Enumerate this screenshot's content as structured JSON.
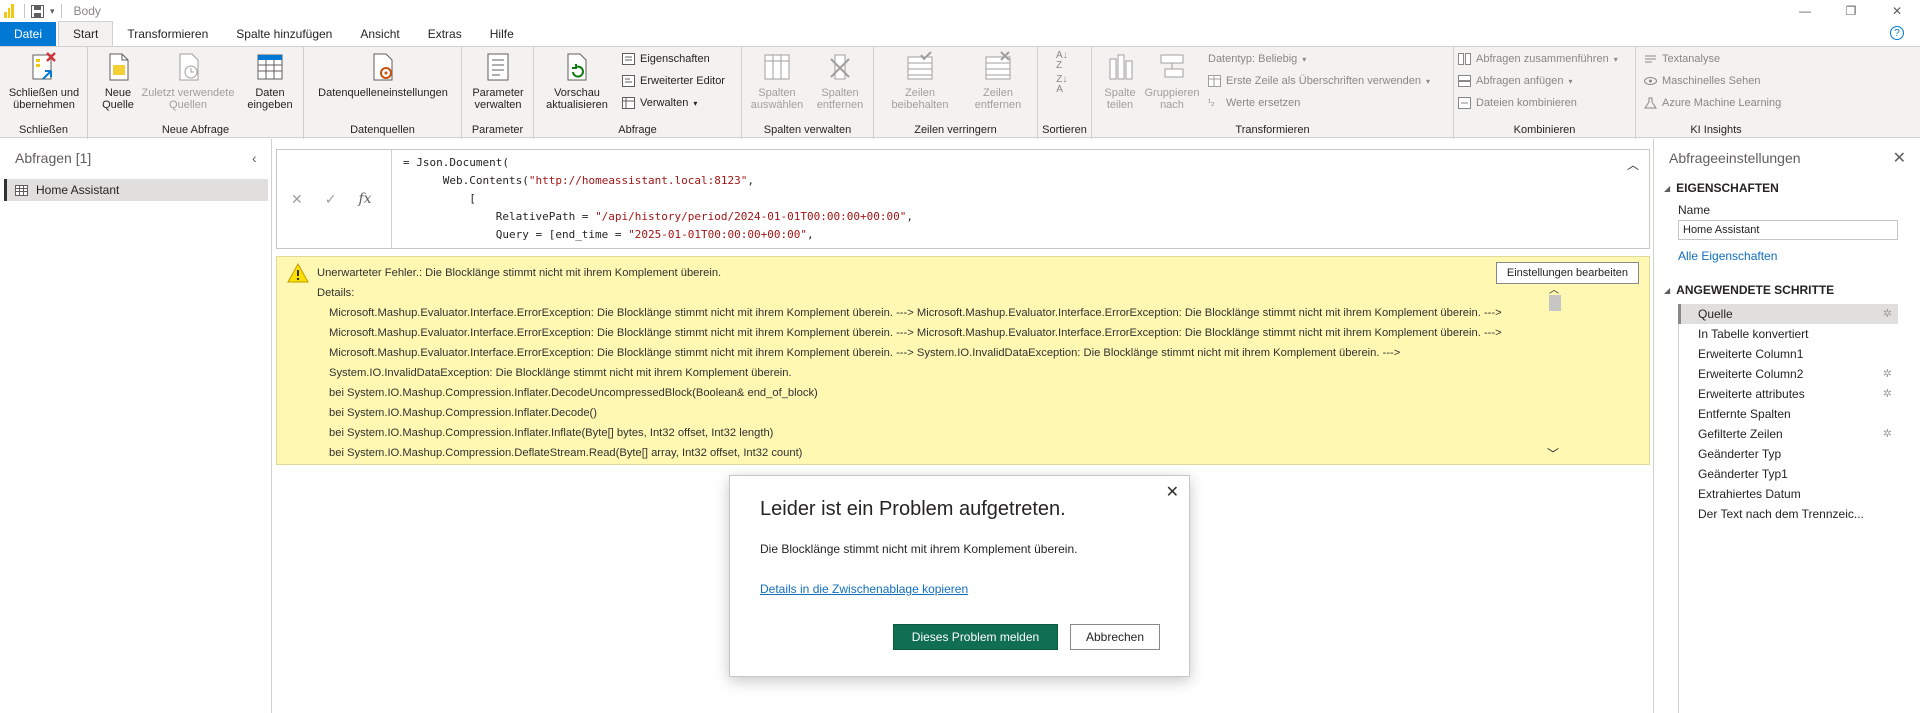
{
  "window": {
    "title": "Body",
    "controls": [
      "—",
      "❐",
      "✕"
    ]
  },
  "tabs": [
    "Datei",
    "Start",
    "Transformieren",
    "Spalte hinzufügen",
    "Ansicht",
    "Extras",
    "Hilfe"
  ],
  "ribbon": {
    "close_apply": "Schließen und übernehmen",
    "group_close": "Schließen",
    "new_source": "Neue Quelle",
    "recent_sources": "Zuletzt verwendete Quellen",
    "enter_data": "Daten eingeben",
    "group_new_query": "Neue Abfrage",
    "ds_settings": "Datenquelleneinstellungen",
    "group_datasources": "Datenquellen",
    "manage_params": "Parameter verwalten",
    "group_params": "Parameter",
    "refresh_preview": "Vorschau aktualisieren",
    "properties": "Eigenschaften",
    "advanced_editor": "Erweiterter Editor",
    "manage": "Verwalten",
    "group_query": "Abfrage",
    "choose_cols": "Spalten auswählen",
    "remove_cols": "Spalten entfernen",
    "group_manage_cols": "Spalten verwalten",
    "keep_rows": "Zeilen beibehalten",
    "remove_rows": "Zeilen entfernen",
    "group_reduce_rows": "Zeilen verringern",
    "group_sort": "Sortieren",
    "split_col": "Spalte teilen",
    "group_by": "Gruppieren nach",
    "datatype": "Datentyp: Beliebig",
    "first_row_headers": "Erste Zeile als Überschriften verwenden",
    "replace_values": "Werte ersetzen",
    "group_transform": "Transformieren",
    "merge_queries": "Abfragen zusammenführen",
    "append_queries": "Abfragen anfügen",
    "combine_files": "Dateien kombinieren",
    "group_combine": "Kombinieren",
    "text_analysis": "Textanalyse",
    "vision": "Maschinelles Sehen",
    "azure_ml": "Azure Machine Learning",
    "group_ai": "KI Insights"
  },
  "queries": {
    "header": "Abfragen [1]",
    "items": [
      "Home Assistant"
    ]
  },
  "formula": {
    "fx": "fx",
    "line1": "= Json.Document(",
    "line2a": "Web.Contents(",
    "line2b": "\"http://homeassistant.local:8123\"",
    "line2c": ",",
    "line3": "[",
    "line4a": "RelativePath = ",
    "line4b": "\"/api/history/period/2024-01-01T00:00:00+00:00\"",
    "line4c": ",",
    "line5a": "Query = [end_time = ",
    "line5b": "\"2025-01-01T00:00:00+00:00\"",
    "line5c": ","
  },
  "error": {
    "headline": "Unerwarteter Fehler.: Die Blocklänge stimmt nicht mit ihrem Komplement überein.",
    "details_label": "Details:",
    "detail_text": "Microsoft.Mashup.Evaluator.Interface.ErrorException: Die Blocklänge stimmt nicht mit ihrem Komplement überein. ---> Microsoft.Mashup.Evaluator.Interface.ErrorException: Die Blocklänge stimmt nicht mit ihrem Komplement überein. ---> Microsoft.Mashup.Evaluator.Interface.ErrorException: Die Blocklänge stimmt nicht mit ihrem Komplement überein. ---> Microsoft.Mashup.Evaluator.Interface.ErrorException: Die Blocklänge stimmt nicht mit ihrem Komplement überein. ---> Microsoft.Mashup.Evaluator.Interface.ErrorException: Die Blocklänge stimmt nicht mit ihrem Komplement überein. ---> System.IO.InvalidDataException: Die Blocklänge stimmt nicht mit ihrem Komplement überein. ---> System.IO.InvalidDataException: Die Blocklänge stimmt nicht mit ihrem Komplement überein.",
    "stack": [
      "bei System.IO.Mashup.Compression.Inflater.DecodeUncompressedBlock(Boolean& end_of_block)",
      "bei System.IO.Mashup.Compression.Inflater.Decode()",
      "bei System.IO.Mashup.Compression.Inflater.Inflate(Byte[] bytes, Int32 offset, Int32 length)",
      "bei System.IO.Mashup.Compression.DeflateStream.Read(Byte[] array, Int32 offset, Int32 count)"
    ],
    "edit_settings": "Einstellungen bearbeiten"
  },
  "settings": {
    "header": "Abfrageeinstellungen",
    "properties_title": "EIGENSCHAFTEN",
    "name_label": "Name",
    "name_value": "Home Assistant",
    "all_props": "Alle Eigenschaften",
    "steps_title": "ANGEWENDETE SCHRITTE",
    "steps": [
      {
        "label": "Quelle",
        "gear": true
      },
      {
        "label": "In Tabelle konvertiert",
        "gear": false
      },
      {
        "label": "Erweiterte Column1",
        "gear": false
      },
      {
        "label": "Erweiterte Column2",
        "gear": true
      },
      {
        "label": "Erweiterte attributes",
        "gear": true
      },
      {
        "label": "Entfernte Spalten",
        "gear": false
      },
      {
        "label": "Gefilterte Zeilen",
        "gear": true
      },
      {
        "label": "Geänderter Typ",
        "gear": false
      },
      {
        "label": "Geänderter Typ1",
        "gear": false
      },
      {
        "label": "Extrahiertes Datum",
        "gear": false
      },
      {
        "label": "Der Text nach dem Trennzeic...",
        "gear": true
      }
    ]
  },
  "dialog": {
    "title": "Leider ist ein Problem aufgetreten.",
    "message": "Die Blocklänge stimmt nicht mit ihrem Komplement überein.",
    "copy_link": "Details in die Zwischenablage kopieren",
    "report": "Dieses Problem melden",
    "cancel": "Abbrechen"
  },
  "colors": {
    "accent": "#0078d4",
    "error_bg": "#fff8b3",
    "report_button": "#106e51"
  }
}
